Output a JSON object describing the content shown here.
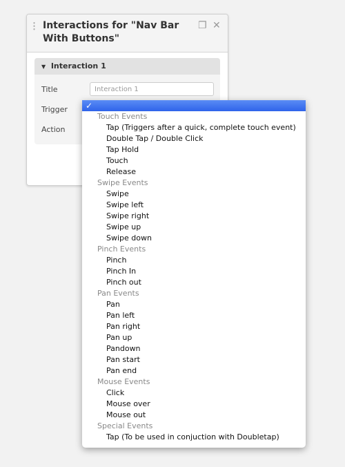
{
  "panel": {
    "title": "Interactions for \"Nav Bar With Buttons\"",
    "icons": [
      "popout-icon",
      "close-icon"
    ]
  },
  "section": {
    "title": "Interaction 1",
    "labels": {
      "title": "Title",
      "trigger": "Trigger",
      "action": "Action"
    },
    "title_placeholder": "Interaction 1"
  },
  "dropdown": {
    "selected": "✓",
    "groups": [
      {
        "label": "Touch Events",
        "items": [
          "Tap (Triggers after a quick, complete touch event)",
          "Double Tap / Double Click",
          "Tap Hold",
          "Touch",
          "Release"
        ]
      },
      {
        "label": "Swipe Events",
        "items": [
          "Swipe",
          "Swipe left",
          "Swipe right",
          "Swipe up",
          "Swipe down"
        ]
      },
      {
        "label": "Pinch Events",
        "items": [
          "Pinch",
          "Pinch In",
          "Pinch out"
        ]
      },
      {
        "label": "Pan Events",
        "items": [
          "Pan",
          "Pan left",
          "Pan right",
          "Pan up",
          "Pandown",
          "Pan start",
          "Pan end"
        ]
      },
      {
        "label": "Mouse Events",
        "items": [
          "Click",
          "Mouse over",
          "Mouse out"
        ]
      },
      {
        "label": "Special Events",
        "items": [
          "Tap (To be used in conjuction with Doubletap)"
        ]
      }
    ]
  },
  "colors": {
    "selected": "#2f63ea"
  }
}
